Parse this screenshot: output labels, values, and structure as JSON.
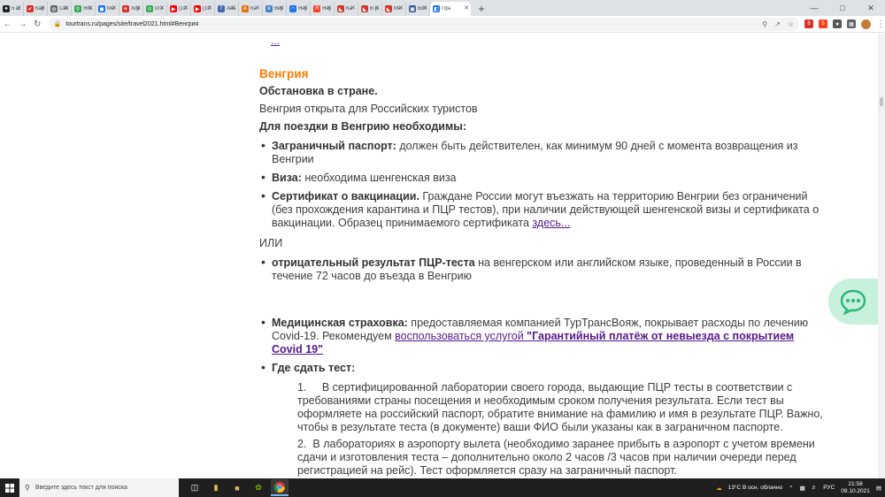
{
  "browser": {
    "tabs": [
      {
        "label": "5 ш",
        "fav_color": "#202124",
        "fav_glyph": "●"
      },
      {
        "label": "Кар",
        "fav_color": "#d93025",
        "fav_glyph": "✔"
      },
      {
        "label": "Сво",
        "fav_color": "#5f6368",
        "fav_glyph": "◍"
      },
      {
        "label": "Япо",
        "fav_color": "#34a853",
        "fav_glyph": "⚲"
      },
      {
        "label": "Ме",
        "fav_color": "#1a73e8",
        "fav_glyph": "◼"
      },
      {
        "label": "Ход",
        "fav_color": "#d93025",
        "fav_glyph": "✈"
      },
      {
        "label": "отз",
        "fav_color": "#34a853",
        "fav_glyph": "⚲"
      },
      {
        "label": "(10",
        "fav_color": "#ff0000",
        "fav_glyph": "▶"
      },
      {
        "label": "(10",
        "fav_color": "#ff0000",
        "fav_glyph": "▶"
      },
      {
        "label": "Авь",
        "fav_color": "#4267b2",
        "fav_glyph": "f"
      },
      {
        "label": "Ка",
        "fav_color": "#e8710a",
        "fav_glyph": "в"
      },
      {
        "label": "Вид",
        "fav_color": "#4680c2",
        "fav_glyph": "в"
      },
      {
        "label": "Янд",
        "fav_color": "#1a73e8",
        "fav_glyph": "◠"
      },
      {
        "label": "Янд",
        "fav_color": "#fc3f1d",
        "fav_glyph": "Я"
      },
      {
        "label": "Ка",
        "fav_color": "#d93025",
        "fav_glyph": "◣"
      },
      {
        "label": "В ра",
        "fav_color": "#d93025",
        "fav_glyph": "◣"
      },
      {
        "label": "Ме",
        "fav_color": "#d93025",
        "fav_glyph": "◣"
      },
      {
        "label": "Воп",
        "fav_color": "#3c5a99",
        "fav_glyph": "▣"
      },
      {
        "label": "Пра",
        "fav_color": "#1a73e8",
        "fav_glyph": "◧",
        "active": true
      }
    ],
    "new_tab_glyph": "+",
    "url": "tourtrans.ru/pages/site/travel2021.html#Венгрия",
    "ext_badge_1": "8",
    "ext_badge_2": "5"
  },
  "page": {
    "top_link": "...",
    "country_heading": "Венгрия",
    "situation_heading": "Обстановка в стране.",
    "situation_text": "Венгрия открыта для Российских туристов",
    "required_heading": "Для поездки в Венгрию необходимы:",
    "items": [
      {
        "bold": "Заграничный паспорт:",
        "text_1": " должен быть действителен, как минимум 90 дней с момента возвращения из",
        "text_2": "Венгрии"
      },
      {
        "bold": "Виза:",
        "text_1": " необходима шенгенская виза"
      },
      {
        "bold": "Сертификат о вакцинации.",
        "text_1": "  Граждане России могут въезжать на территорию Венгрии без ограничений",
        "text_2": "(без прохождения карантина и ПЦР тестов), при наличии действующей шенгенской визы и сертификата о",
        "text_3": "вакцинации. Образец принимаемого сертификата ",
        "link": "здесь..."
      }
    ],
    "or_text": "ИЛИ",
    "pcr_item": {
      "bold": "отрицательный результат ПЦР-теста",
      "text_1": " на венгерском или английском языке, проведенный в России в",
      "text_2": "течение 72 часов до въезда в Венгрию"
    },
    "insurance_item": {
      "bold": "Медицинская страховка:",
      "text_1": " предоставляемая компанией ТурТрансВояж, покрывает расходы по лечению",
      "text_2": "Covid-19. Рекомендуем ",
      "link_1": "воспользоваться услугой ",
      "link_bold_1": "\"Гарантийный платёж от невыезда с покрытием",
      "link_bold_2": "Covid 19\""
    },
    "test_heading": "Где сдать тест:",
    "steps": [
      {
        "num": "1.",
        "line_1": "В сертифицированной лаборатории своего города, выдающие ПЦР тесты в соответствии с",
        "line_2": "требованиями страны посещения и необходимым сроком получения результата. Если тест вы",
        "line_3": "оформляете на российский паспорт, обратите внимание на фамилию и имя в результате ПЦР. Важно,",
        "line_4": "чтобы в результате теста (в документе) ваши ФИО были указаны как в заграничном паспорте."
      },
      {
        "num": "2.",
        "line_1": "В лабораториях в аэропорту вылета (необходимо заранее прибыть в аэропорт с учетом времени",
        "line_2": "сдачи и изготовления теста – дополнительно около 2 часов /3 часов при наличии очереди перед",
        "line_3": "регистрацией на рейс). Тест оформляется сразу на заграничный паспорт."
      }
    ]
  },
  "taskbar": {
    "search_placeholder": "Введите здесь текст для поиска",
    "weather": "13°C  В осн. облачно",
    "lang": "РУС",
    "time": "21:58",
    "date": "09.10.2021"
  },
  "colors": {
    "accent_orange": "#ff7b00",
    "link": "#551a8b",
    "chat_bg": "#c7f0dd",
    "chat_icon": "#2bb673"
  }
}
